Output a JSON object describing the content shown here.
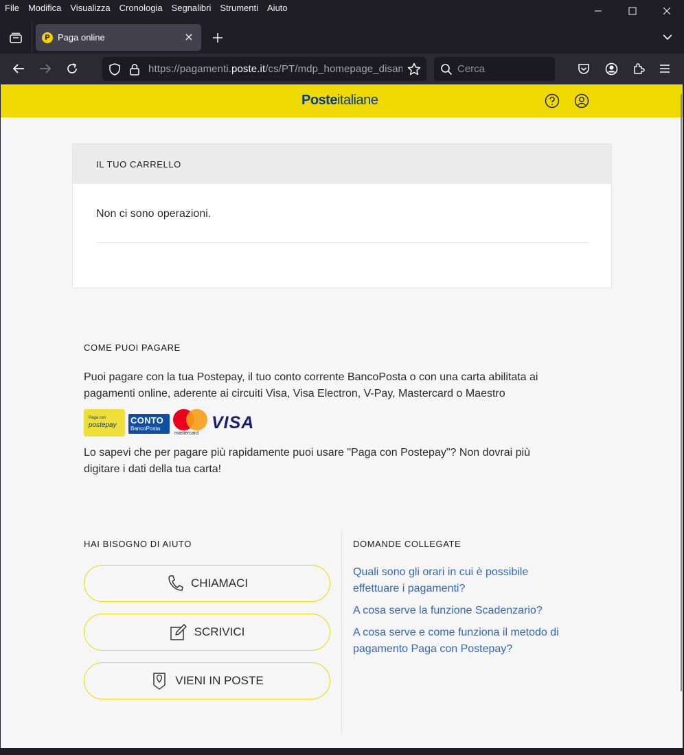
{
  "menu": [
    "File",
    "Modifica",
    "Visualizza",
    "Cronologia",
    "Segnalibri",
    "Strumenti",
    "Aiuto"
  ],
  "tab": {
    "favicon_letter": "P",
    "title": "Paga online"
  },
  "nav": {
    "url_prefix": "https://pagamenti.",
    "url_domain": "poste.it",
    "url_suffix": "/cs/PT/mdp_homepage_disamb",
    "search_placeholder": "Cerca"
  },
  "header": {
    "logo_bold": "Poste",
    "logo_light": "italiane"
  },
  "cart": {
    "title": "IL TUO CARRELLO",
    "empty_text": "Non ci sono operazioni."
  },
  "payment": {
    "title": "COME PUOI PAGARE",
    "line1": "Puoi pagare con la tua Postepay, il tuo conto corrente BancoPosta o con una carta abilitata ai",
    "line2": "pagamenti online, aderente ai circuiti Visa, Visa Electron, V-Pay, Mastercard o Maestro",
    "cards": {
      "postepay_small": "Paga con",
      "postepay_big": "postepay",
      "conto_big": "CONTO",
      "conto_small": "BancoPosta",
      "mastercard": "mastercard",
      "visa": "VISA"
    },
    "tip_line1": "Lo sapevi che per pagare più rapidamente puoi usare \"Paga con Postepay\"? Non dovrai più",
    "tip_line2": "digitare i dati della tua carta!"
  },
  "help": {
    "title": "HAI BISOGNO DI AIUTO",
    "buttons": [
      {
        "label": "CHIAMACI",
        "icon": "phone-icon"
      },
      {
        "label": "SCRIVICI",
        "icon": "edit-icon"
      },
      {
        "label": "VIENI IN POSTE",
        "icon": "location-icon"
      }
    ]
  },
  "related": {
    "title": "DOMANDE COLLEGATE",
    "links": [
      {
        "line1": "Quali sono gli orari in cui è possibile",
        "line2": "effettuare i pagamenti?"
      },
      {
        "line1": "A cosa serve la funzione Scadenzario?",
        "line2": ""
      },
      {
        "line1": "A cosa serve e come funziona il metodo di",
        "line2": "pagamento Paga con Postepay?"
      }
    ]
  },
  "colors": {
    "brand_yellow": "#eed900",
    "brand_blue": "#0a3b8c",
    "link_blue": "#2f68b8"
  }
}
